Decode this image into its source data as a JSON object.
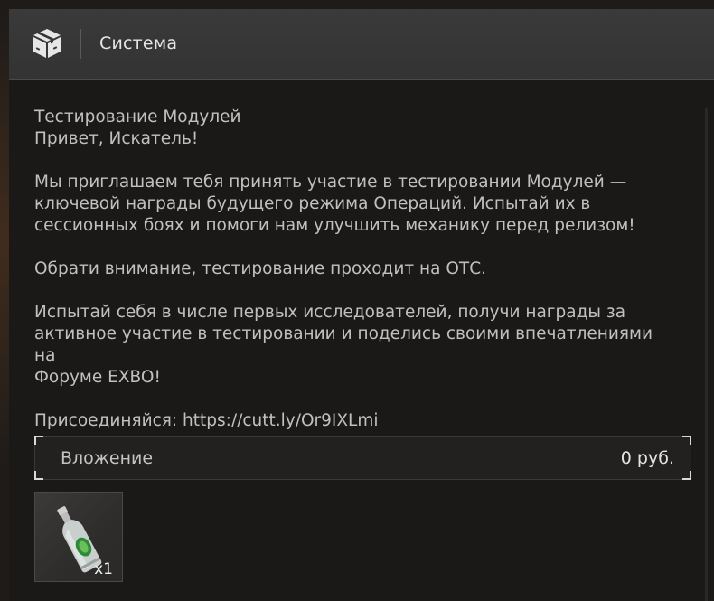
{
  "header": {
    "title": "Система",
    "icon": "package-box-icon"
  },
  "message": {
    "subject": "Тестирование Модулей",
    "greeting": "Привет, Искатель!",
    "para1_line1": "Мы приглашаем тебя принять участие в тестировании Модулей —",
    "para1_line2": "ключевой награды будущего режима Операций. Испытай их в",
    "para1_line3": "сессионных боях и помоги нам улучшить механику перед релизом!",
    "para2": "Обрати внимание, тестирование проходит на ОТС.",
    "para3_line1": "Испытай себя в числе первых исследователей, получи награды за",
    "para3_line2": "активное участие в тестировании и поделись своими впечатлениями на",
    "para3_line3": "Форуме EXBO!",
    "join": "Присоединяйся: https://cutt.ly/Or9IXLmi"
  },
  "attachment": {
    "label": "Вложение",
    "price": "0  руб."
  },
  "item": {
    "icon": "bottle-item-icon",
    "quantity": "x1"
  },
  "colors": {
    "header_bg": "#363636",
    "window_bg": "#1b1918",
    "text": "#c2c0bd"
  }
}
